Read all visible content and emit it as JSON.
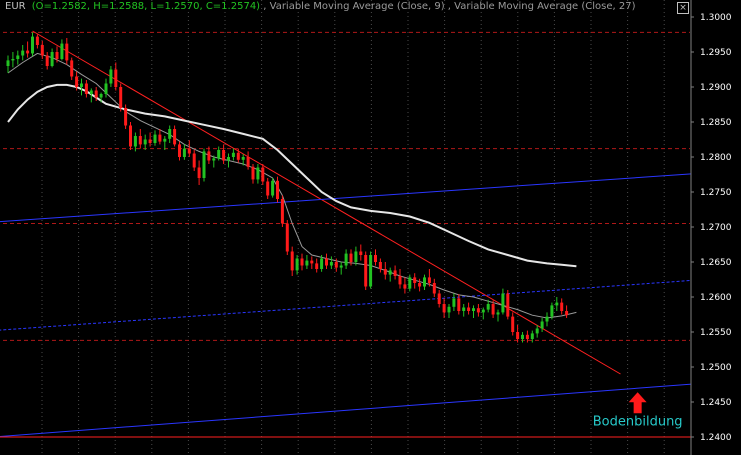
{
  "header": {
    "symbol": "EUR",
    "ohlc": "(O=1.2582, H=1.2588, L=1.2570, C=1.2574)",
    "sep1": " ,  ",
    "ma_fast": "Variable Moving Average (Close, 9)",
    "sep2": " ,  ",
    "ma_slow": "Variable Moving Average (Close, 27)"
  },
  "close_icon": "close-icon",
  "colors": {
    "background": "#000000",
    "bull": "#22c322",
    "bear": "#ff1a1a",
    "ma_fast": "#9a9a9a",
    "ma_slow": "#e6e6e6",
    "trend_red": "#ff2020",
    "channel_blue": "#2a36ff",
    "grid_red": "#b01818",
    "grid_vertical": "#4a4a4a",
    "annotation": "#27c9c9",
    "arrow": "#ff1a1a",
    "header_symbol": "#c0c0c0",
    "header_ohlc": "#22c322",
    "header_ma": "#9a9a9a"
  },
  "chart_data": {
    "type": "candlestick",
    "instrument": "EUR",
    "ylim": [
      1.238,
      1.302
    ],
    "yticks": [
      "1.3000",
      "1.2950",
      "1.2900",
      "1.2850",
      "1.2800",
      "1.2750",
      "1.2700",
      "1.2650",
      "1.2600",
      "1.2550",
      "1.2500",
      "1.2450",
      "1.2400"
    ],
    "grid": "dashed red horizontal lines, dotted vertical lines",
    "series": [
      {
        "name": "Variable Moving Average (Close, 9)",
        "points": [
          [
            0,
            1.292
          ],
          [
            3,
            1.2935
          ],
          [
            6,
            1.2948
          ],
          [
            9,
            1.2942
          ],
          [
            12,
            1.2932
          ],
          [
            15,
            1.2918
          ],
          [
            18,
            1.2905
          ],
          [
            21,
            1.2885
          ],
          [
            24,
            1.2865
          ],
          [
            27,
            1.2852
          ],
          [
            30,
            1.2842
          ],
          [
            33,
            1.2832
          ],
          [
            36,
            1.2818
          ],
          [
            39,
            1.2808
          ],
          [
            42,
            1.28
          ],
          [
            45,
            1.2795
          ],
          [
            48,
            1.279
          ],
          [
            51,
            1.2782
          ],
          [
            54,
            1.277
          ],
          [
            56,
            1.2745
          ],
          [
            58,
            1.2705
          ],
          [
            60,
            1.2672
          ],
          [
            62,
            1.266
          ],
          [
            65,
            1.2655
          ],
          [
            68,
            1.265
          ],
          [
            71,
            1.2648
          ],
          [
            74,
            1.2645
          ],
          [
            77,
            1.2638
          ],
          [
            80,
            1.263
          ],
          [
            83,
            1.2624
          ],
          [
            86,
            1.2618
          ],
          [
            89,
            1.261
          ],
          [
            92,
            1.2603
          ],
          [
            95,
            1.26
          ],
          [
            98,
            1.2594
          ],
          [
            101,
            1.2588
          ],
          [
            104,
            1.2582
          ],
          [
            107,
            1.2574
          ],
          [
            110,
            1.257
          ],
          [
            113,
            1.2573
          ],
          [
            116,
            1.2578
          ]
        ]
      },
      {
        "name": "Variable Moving Average (Close, 27)",
        "points": [
          [
            0,
            1.285
          ],
          [
            2,
            1.2868
          ],
          [
            4,
            1.2882
          ],
          [
            6,
            1.2893
          ],
          [
            8,
            1.29
          ],
          [
            10,
            1.2903
          ],
          [
            12,
            1.2903
          ],
          [
            14,
            1.29
          ],
          [
            16,
            1.2894
          ],
          [
            18,
            1.2885
          ],
          [
            20,
            1.2876
          ],
          [
            24,
            1.2868
          ],
          [
            28,
            1.2862
          ],
          [
            32,
            1.2858
          ],
          [
            36,
            1.2852
          ],
          [
            40,
            1.2846
          ],
          [
            44,
            1.284
          ],
          [
            48,
            1.2833
          ],
          [
            52,
            1.2826
          ],
          [
            55,
            1.281
          ],
          [
            58,
            1.279
          ],
          [
            61,
            1.277
          ],
          [
            64,
            1.275
          ],
          [
            67,
            1.2737
          ],
          [
            70,
            1.2728
          ],
          [
            74,
            1.2723
          ],
          [
            78,
            1.272
          ],
          [
            82,
            1.2715
          ],
          [
            86,
            1.2706
          ],
          [
            90,
            1.2693
          ],
          [
            94,
            1.268
          ],
          [
            98,
            1.2668
          ],
          [
            102,
            1.266
          ],
          [
            106,
            1.2652
          ],
          [
            110,
            1.2648
          ],
          [
            113,
            1.2646
          ],
          [
            116,
            1.2644
          ]
        ]
      }
    ],
    "candles_ohlc": [
      [
        1.293,
        1.2945,
        1.292,
        1.2938
      ],
      [
        1.2938,
        1.295,
        1.2928,
        1.294
      ],
      [
        1.294,
        1.2952,
        1.2932,
        1.2945
      ],
      [
        1.2945,
        1.296,
        1.2938,
        1.2952
      ],
      [
        1.2952,
        1.2965,
        1.2942,
        1.2948
      ],
      [
        1.2948,
        1.2978,
        1.2944,
        1.2972
      ],
      [
        1.2972,
        1.2975,
        1.2955,
        1.296
      ],
      [
        1.296,
        1.2966,
        1.294,
        1.2945
      ],
      [
        1.2945,
        1.295,
        1.2925,
        1.293
      ],
      [
        1.293,
        1.2955,
        1.2928,
        1.295
      ],
      [
        1.295,
        1.2958,
        1.2935,
        1.294
      ],
      [
        1.294,
        1.2968,
        1.2938,
        1.2962
      ],
      [
        1.2962,
        1.297,
        1.2932,
        1.2938
      ],
      [
        1.2938,
        1.2942,
        1.291,
        1.2915
      ],
      [
        1.2915,
        1.2922,
        1.2895,
        1.29
      ],
      [
        1.29,
        1.2912,
        1.2888,
        1.2905
      ],
      [
        1.2905,
        1.291,
        1.2885,
        1.289
      ],
      [
        1.289,
        1.2898,
        1.2878,
        1.2895
      ],
      [
        1.2895,
        1.29,
        1.288,
        1.2885
      ],
      [
        1.2885,
        1.2892,
        1.2878,
        1.289
      ],
      [
        1.289,
        1.2912,
        1.2885,
        1.2905
      ],
      [
        1.2905,
        1.293,
        1.29,
        1.2925
      ],
      [
        1.2925,
        1.2935,
        1.2895,
        1.29
      ],
      [
        1.29,
        1.2905,
        1.2865,
        1.287
      ],
      [
        1.287,
        1.2875,
        1.284,
        1.2845
      ],
      [
        1.2845,
        1.285,
        1.281,
        1.2815
      ],
      [
        1.2815,
        1.2835,
        1.2808,
        1.283
      ],
      [
        1.283,
        1.284,
        1.2812,
        1.2818
      ],
      [
        1.2818,
        1.2832,
        1.281,
        1.2825
      ],
      [
        1.2825,
        1.2835,
        1.2815,
        1.282
      ],
      [
        1.282,
        1.2838,
        1.2816,
        1.2832
      ],
      [
        1.2832,
        1.284,
        1.2818,
        1.2822
      ],
      [
        1.2822,
        1.283,
        1.281,
        1.2826
      ],
      [
        1.2826,
        1.2845,
        1.282,
        1.284
      ],
      [
        1.284,
        1.2845,
        1.2815,
        1.2818
      ],
      [
        1.2818,
        1.2822,
        1.2795,
        1.28
      ],
      [
        1.28,
        1.2818,
        1.2796,
        1.2812
      ],
      [
        1.2812,
        1.2824,
        1.28,
        1.2805
      ],
      [
        1.2805,
        1.281,
        1.278,
        1.2785
      ],
      [
        1.2785,
        1.2795,
        1.276,
        1.277
      ],
      [
        1.277,
        1.2812,
        1.2765,
        1.2808
      ],
      [
        1.2808,
        1.2815,
        1.279,
        1.2795
      ],
      [
        1.2795,
        1.2802,
        1.2785,
        1.2798
      ],
      [
        1.2798,
        1.2815,
        1.2795,
        1.281
      ],
      [
        1.281,
        1.2818,
        1.279,
        1.2795
      ],
      [
        1.2795,
        1.2805,
        1.2785,
        1.28
      ],
      [
        1.28,
        1.2812,
        1.2795,
        1.2806
      ],
      [
        1.2806,
        1.2812,
        1.2792,
        1.2796
      ],
      [
        1.2796,
        1.2804,
        1.2788,
        1.28
      ],
      [
        1.28,
        1.2808,
        1.2782,
        1.2786
      ],
      [
        1.2786,
        1.279,
        1.2762,
        1.2768
      ],
      [
        1.2768,
        1.279,
        1.2762,
        1.2785
      ],
      [
        1.2785,
        1.279,
        1.276,
        1.2765
      ],
      [
        1.2765,
        1.277,
        1.274,
        1.2745
      ],
      [
        1.2745,
        1.277,
        1.2742,
        1.2766
      ],
      [
        1.2766,
        1.2772,
        1.2735,
        1.274
      ],
      [
        1.274,
        1.2745,
        1.27,
        1.2705
      ],
      [
        1.2705,
        1.271,
        1.266,
        1.2665
      ],
      [
        1.2665,
        1.2672,
        1.263,
        1.2638
      ],
      [
        1.2638,
        1.266,
        1.2632,
        1.2655
      ],
      [
        1.2655,
        1.2662,
        1.2638,
        1.2645
      ],
      [
        1.2645,
        1.266,
        1.264,
        1.2652
      ],
      [
        1.2652,
        1.2658,
        1.264,
        1.2648
      ],
      [
        1.2648,
        1.2655,
        1.2635,
        1.264
      ],
      [
        1.264,
        1.266,
        1.2636,
        1.2655
      ],
      [
        1.2655,
        1.2662,
        1.264,
        1.2645
      ],
      [
        1.2645,
        1.2658,
        1.264,
        1.265
      ],
      [
        1.265,
        1.2655,
        1.2636,
        1.2642
      ],
      [
        1.2642,
        1.265,
        1.2632,
        1.2645
      ],
      [
        1.2645,
        1.2668,
        1.264,
        1.2662
      ],
      [
        1.2662,
        1.2668,
        1.2645,
        1.265
      ],
      [
        1.265,
        1.2672,
        1.2645,
        1.2665
      ],
      [
        1.2665,
        1.2675,
        1.2652,
        1.266
      ],
      [
        1.266,
        1.2665,
        1.261,
        1.2615
      ],
      [
        1.2615,
        1.2665,
        1.2612,
        1.266
      ],
      [
        1.266,
        1.2668,
        1.2645,
        1.265
      ],
      [
        1.265,
        1.2655,
        1.2635,
        1.264
      ],
      [
        1.264,
        1.265,
        1.2625,
        1.2632
      ],
      [
        1.2632,
        1.2642,
        1.2622,
        1.2638
      ],
      [
        1.2638,
        1.2645,
        1.2625,
        1.263
      ],
      [
        1.263,
        1.264,
        1.2612,
        1.2618
      ],
      [
        1.2618,
        1.2628,
        1.2605,
        1.2612
      ],
      [
        1.2612,
        1.2632,
        1.2608,
        1.2628
      ],
      [
        1.2628,
        1.2634,
        1.2612,
        1.262
      ],
      [
        1.262,
        1.2626,
        1.2608,
        1.2615
      ],
      [
        1.2615,
        1.2632,
        1.261,
        1.2628
      ],
      [
        1.2628,
        1.264,
        1.2615,
        1.262
      ],
      [
        1.262,
        1.2626,
        1.26,
        1.2605
      ],
      [
        1.2605,
        1.261,
        1.2585,
        1.259
      ],
      [
        1.259,
        1.2598,
        1.257,
        1.2578
      ],
      [
        1.2578,
        1.259,
        1.257,
        1.2586
      ],
      [
        1.2586,
        1.2605,
        1.258,
        1.2598
      ],
      [
        1.2598,
        1.2604,
        1.2575,
        1.258
      ],
      [
        1.258,
        1.259,
        1.2572,
        1.2585
      ],
      [
        1.2585,
        1.2592,
        1.2575,
        1.258
      ],
      [
        1.258,
        1.2588,
        1.257,
        1.2584
      ],
      [
        1.2584,
        1.259,
        1.2572,
        1.2578
      ],
      [
        1.2578,
        1.2585,
        1.2568,
        1.2582
      ],
      [
        1.2582,
        1.2596,
        1.2578,
        1.259
      ],
      [
        1.259,
        1.2595,
        1.257,
        1.2575
      ],
      [
        1.2575,
        1.2582,
        1.2565,
        1.2578
      ],
      [
        1.2578,
        1.2612,
        1.2575,
        1.2605
      ],
      [
        1.2605,
        1.261,
        1.2568,
        1.2572
      ],
      [
        1.2572,
        1.2578,
        1.2545,
        1.255
      ],
      [
        1.255,
        1.256,
        1.2535,
        1.254
      ],
      [
        1.254,
        1.255,
        1.2535,
        1.2546
      ],
      [
        1.2546,
        1.2552,
        1.2535,
        1.254
      ],
      [
        1.254,
        1.2552,
        1.2535,
        1.2548
      ],
      [
        1.2548,
        1.256,
        1.2542,
        1.2555
      ],
      [
        1.2555,
        1.257,
        1.255,
        1.2565
      ],
      [
        1.2565,
        1.2578,
        1.2558,
        1.2572
      ],
      [
        1.2572,
        1.2592,
        1.2568,
        1.2588
      ],
      [
        1.2588,
        1.26,
        1.258,
        1.2592
      ],
      [
        1.2592,
        1.2598,
        1.2575,
        1.258
      ],
      [
        1.258,
        1.2588,
        1.257,
        1.2574
      ]
    ],
    "drawings": [
      {
        "name": "downtrend-line",
        "kind": "trend_red",
        "from": [
          5,
          1.298
        ],
        "to": [
          125,
          1.249
        ]
      },
      {
        "name": "channel-upper",
        "kind": "channel_blue",
        "solid": true,
        "from": [
          -3,
          1.2707
        ],
        "to": [
          148,
          1.278
        ]
      },
      {
        "name": "channel-middle",
        "kind": "channel_blue",
        "solid": false,
        "from": [
          -3,
          1.2552
        ],
        "to": [
          148,
          1.2628
        ]
      },
      {
        "name": "channel-lower",
        "kind": "channel_blue",
        "solid": true,
        "from": [
          -3,
          1.24
        ],
        "to": [
          148,
          1.248
        ]
      },
      {
        "name": "horizontal-support",
        "kind": "trend_red",
        "solid": true,
        "from": [
          -3,
          1.24
        ],
        "to": [
          148,
          1.24
        ]
      }
    ],
    "red_level_lines": [
      1.2978,
      1.2812,
      1.2705,
      1.2538
    ],
    "annotations": [
      {
        "text": "Bodenbildung",
        "x": 128.5,
        "y": 1.2422,
        "arrow_to": 1.2464
      }
    ]
  }
}
